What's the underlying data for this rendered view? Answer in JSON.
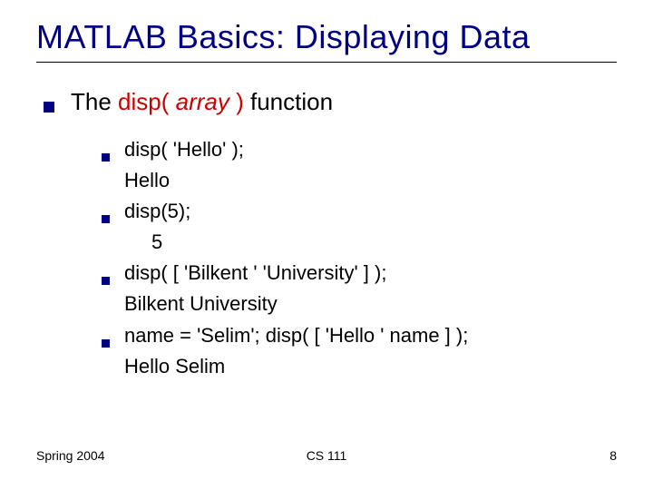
{
  "title": "MATLAB Basics: Displaying Data",
  "main": {
    "prefix": "The ",
    "disp": "disp(",
    "array": " array ",
    "paren_close": ")",
    "suffix": " function"
  },
  "examples": [
    {
      "code": "disp( 'Hello' );",
      "output": "Hello",
      "output_class": "output-indent"
    },
    {
      "code": "disp(5);",
      "output": "5",
      "output_class": "output-indent num"
    },
    {
      "code": "disp( [ 'Bilkent ' 'University' ] );",
      "output": "Bilkent University",
      "output_class": "output-indent"
    },
    {
      "code": "name = 'Selim'; disp( [ 'Hello ' name ] );",
      "output": "Hello Selim",
      "output_class": "output-indent"
    }
  ],
  "footer": {
    "left": "Spring 2004",
    "center": "CS 111",
    "right": "8"
  }
}
